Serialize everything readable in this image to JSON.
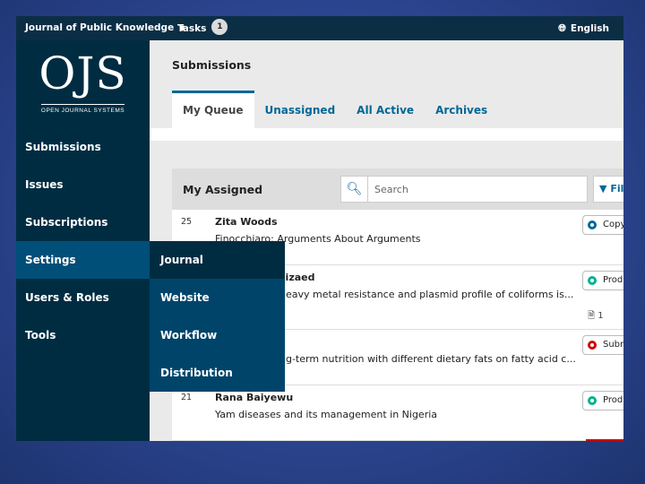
{
  "topbar": {
    "journal_name": "Journal of Public Knowledge",
    "tasks_label": "Tasks",
    "tasks_count": "1",
    "language": "English"
  },
  "logo": {
    "mark": "OJS",
    "subtitle": "OPEN JOURNAL SYSTEMS"
  },
  "sidebar": {
    "items": [
      {
        "label": "Submissions"
      },
      {
        "label": "Issues"
      },
      {
        "label": "Subscriptions"
      },
      {
        "label": "Settings"
      },
      {
        "label": "Users & Roles"
      },
      {
        "label": "Tools"
      }
    ]
  },
  "submenu": {
    "items": [
      {
        "label": "Journal"
      },
      {
        "label": "Website"
      },
      {
        "label": "Workflow"
      },
      {
        "label": "Distribution"
      }
    ]
  },
  "main": {
    "title": "Submissions",
    "tabs": [
      {
        "label": "My Queue"
      },
      {
        "label": "Unassigned"
      },
      {
        "label": "All Active"
      },
      {
        "label": "Archives"
      }
    ]
  },
  "panel": {
    "title": "My Assigned",
    "search_placeholder": "Search",
    "filter_label": "Fil",
    "rows": [
      {
        "id": "25",
        "author": "Zita Woods",
        "title": "Finocchiaro: Arguments About Arguments",
        "stage": "Copye",
        "files": ""
      },
      {
        "id": "",
        "author": "sizaed",
        "title": "heavy metal resistance and plasmid profile of coliforms is...",
        "stage": "Produ",
        "files": "1"
      },
      {
        "id": "",
        "author": "i",
        "title": "ng-term nutrition with different dietary fats on fatty acid c...",
        "stage": "Subm",
        "files": ""
      },
      {
        "id": "21",
        "author": "Rana Baiyewu",
        "title": "Yam diseases and its management in Nigeria",
        "stage": "Produ",
        "files": ""
      }
    ]
  }
}
